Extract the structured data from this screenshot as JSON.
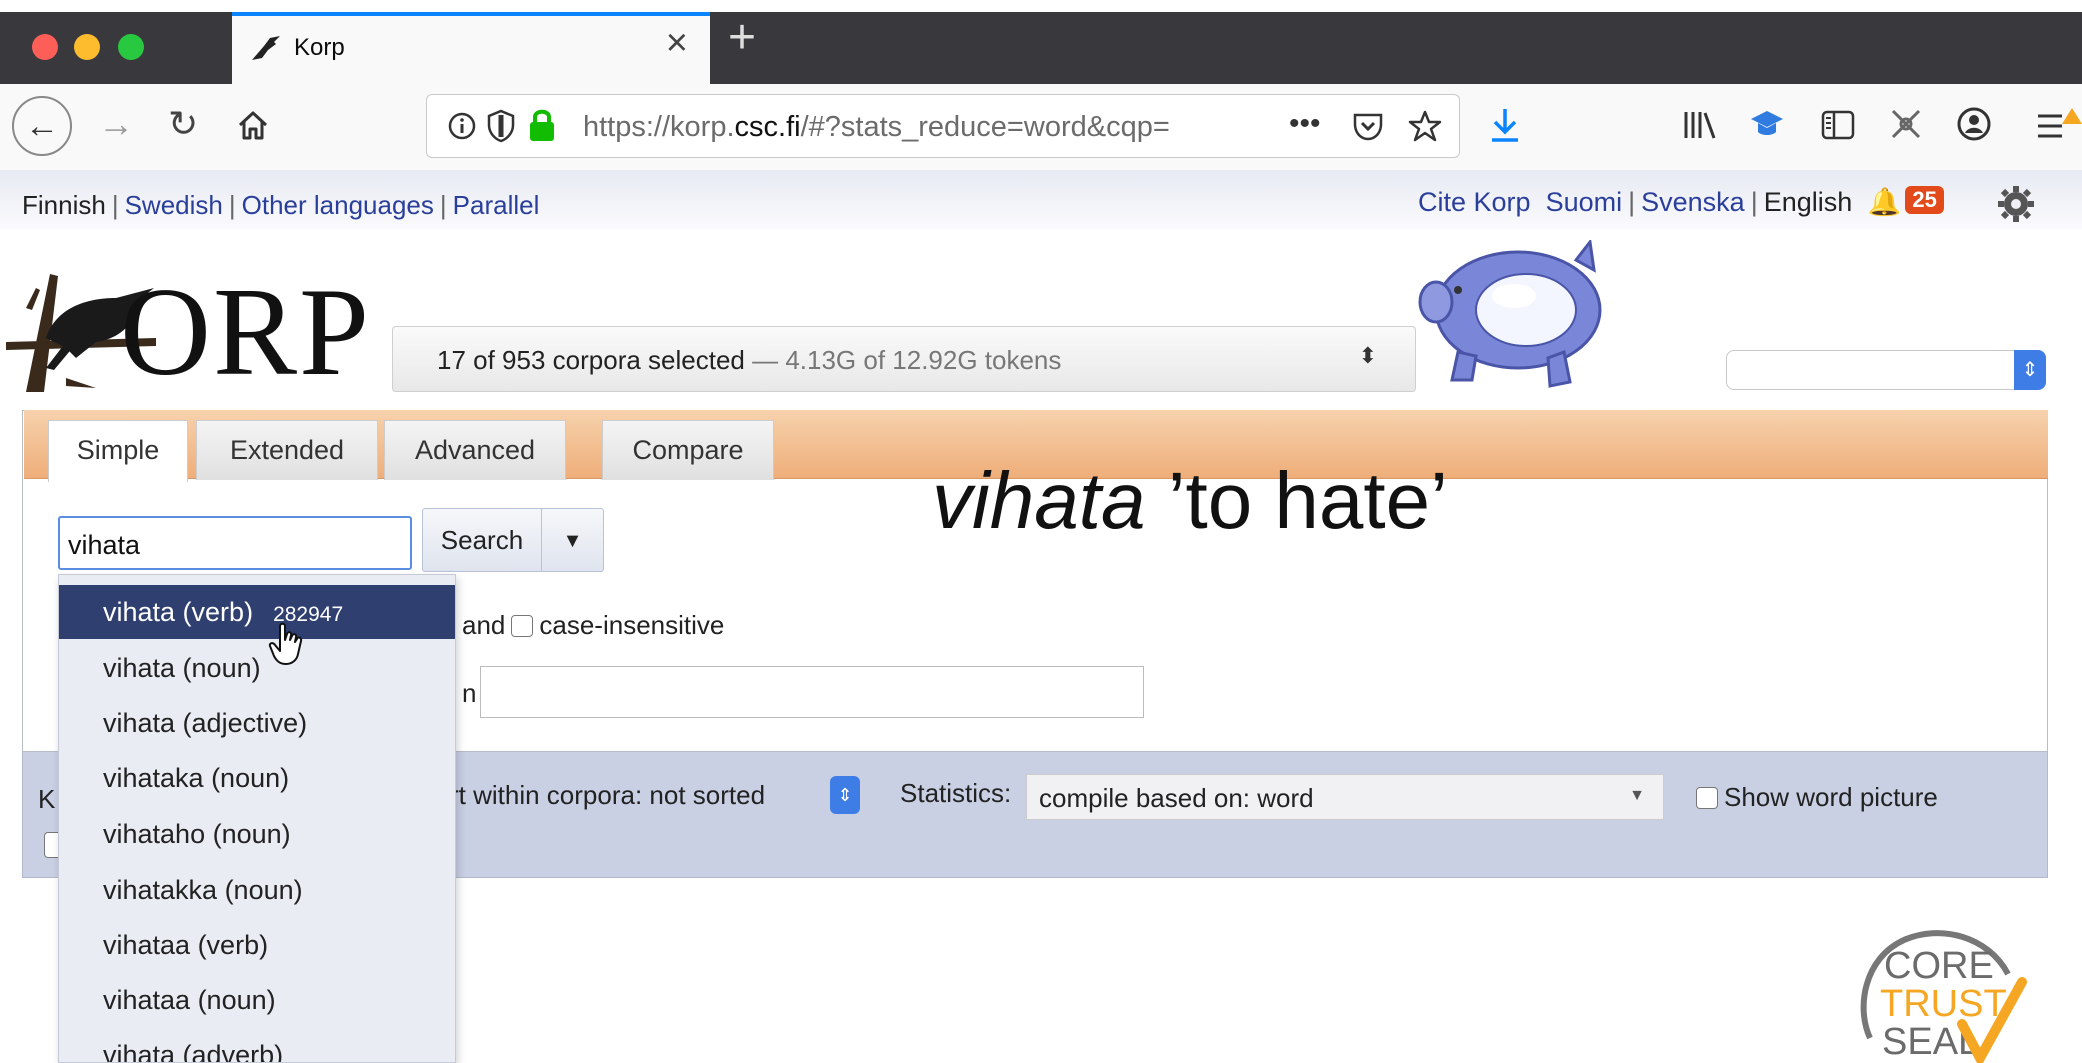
{
  "browser": {
    "tab_title": "Korp",
    "new_tab_symbol": "+",
    "url_prefix": "https://korp.",
    "url_domain": "csc.fi",
    "url_rest": "/#?stats_reduce=word&cqp=",
    "url_more": "•••"
  },
  "korp": {
    "lang_links": [
      "Finnish",
      "Swedish",
      "Other languages",
      "Parallel"
    ],
    "cite": "Cite Korp",
    "ui_langs": [
      "Suomi",
      "Svenska",
      "English"
    ],
    "notifications": "25",
    "logo_text": "ORP",
    "corpus_selected": "17 of 953 corpora selected",
    "corpus_tokens": " — 4.13G of 12.92G tokens",
    "tabs": [
      "Simple",
      "Extended",
      "Advanced",
      "Compare"
    ],
    "search_value": "vihata",
    "search_button": "Search",
    "and_label": "and",
    "case_insensitive": "case-insensitive",
    "within_prefix": "n",
    "kwic_prefix": "K",
    "sort_label": "rt within corpora: not sorted",
    "stats_label": "Statistics:",
    "stats_value": "compile based on: word",
    "show_word_picture": "Show word picture",
    "autocomplete": [
      {
        "label": "vihata (verb)",
        "count": "282947"
      },
      {
        "label": "vihata (noun)"
      },
      {
        "label": "vihata (adjective)"
      },
      {
        "label": "vihataka (noun)"
      },
      {
        "label": "vihataho (noun)"
      },
      {
        "label": "vihatakka (noun)"
      },
      {
        "label": "vihataa (verb)"
      },
      {
        "label": "vihataa (noun)"
      },
      {
        "label": "vihata (adverb)"
      }
    ],
    "seal_lines": [
      "CORE",
      "TRUST",
      "SEAL"
    ]
  },
  "overlay": {
    "word": "vihata",
    "gloss": " ’to hate’"
  },
  "colors": {
    "accent": "#3f7de6",
    "tab_bar": "#eeae79",
    "link": "#2a3f9a",
    "selected_item": "#2f3f70",
    "badge": "#e24a1b",
    "seal_orange": "#f5a623"
  }
}
